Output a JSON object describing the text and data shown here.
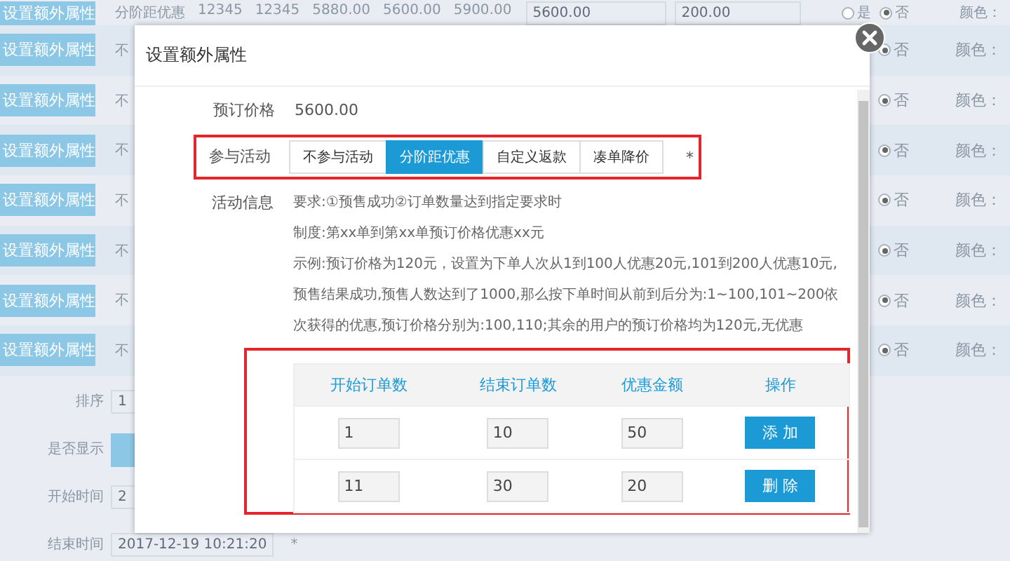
{
  "background": {
    "rows": [
      {
        "button": "设置额外属性",
        "cells": [
          "分阶距优惠",
          "12345",
          "12345",
          "5880.00",
          "5600.00",
          "5900.00"
        ],
        "fields": [
          "5600.00",
          "200.00"
        ],
        "radio": [
          {
            "label": "是",
            "selected": false
          },
          {
            "label": "否",
            "selected": true
          }
        ],
        "color_label": "颜色："
      },
      {
        "button": "设置额外属性",
        "cells": [
          "不"
        ],
        "fields": [],
        "radio": [
          {
            "label": "否",
            "selected": true
          }
        ],
        "color_label": "颜色："
      },
      {
        "button": "设置额外属性",
        "cells": [
          "不"
        ],
        "fields": [],
        "radio": [
          {
            "label": "否",
            "selected": true
          }
        ],
        "color_label": "颜色："
      },
      {
        "button": "设置额外属性",
        "cells": [
          "不"
        ],
        "fields": [],
        "radio": [
          {
            "label": "否",
            "selected": true
          }
        ],
        "color_label": "颜色："
      },
      {
        "button": "设置额外属性",
        "cells": [
          "不"
        ],
        "fields": [],
        "radio": [
          {
            "label": "否",
            "selected": true
          }
        ],
        "color_label": "颜色："
      },
      {
        "button": "设置额外属性",
        "cells": [
          "不"
        ],
        "fields": [],
        "radio": [
          {
            "label": "否",
            "selected": true
          }
        ],
        "color_label": "颜色："
      },
      {
        "button": "设置额外属性",
        "cells": [
          "不"
        ],
        "fields": [],
        "radio": [
          {
            "label": "否",
            "selected": true
          }
        ],
        "color_label": "颜色："
      },
      {
        "button": "设置额外属性",
        "cells": [
          "不"
        ],
        "fields": [],
        "radio": [
          {
            "label": "否",
            "selected": true
          }
        ],
        "color_label": "颜色："
      }
    ],
    "form": [
      {
        "label": "排序",
        "kind": "field",
        "value": "1"
      },
      {
        "label": "是否显示",
        "kind": "button"
      },
      {
        "label": "开始时间",
        "kind": "field",
        "value": "2"
      },
      {
        "label": "结束时间",
        "kind": "field",
        "value": "2017-12-19 10:21:20",
        "required": "*"
      }
    ]
  },
  "dialog": {
    "title": "设置额外属性",
    "price": {
      "label": "预订价格",
      "value": "5600.00"
    },
    "activity": {
      "label": "参与活动",
      "options": [
        {
          "label": "不参与活动",
          "selected": false
        },
        {
          "label": "分阶距优惠",
          "selected": true
        },
        {
          "label": "自定义返款",
          "selected": false
        },
        {
          "label": "凑单降价",
          "selected": false
        }
      ],
      "required": "*"
    },
    "info": {
      "label": "活动信息",
      "lines": [
        "要求:①预售成功②订单数量达到指定要求时",
        "制度:第xx单到第xx单预订价格优惠xx元",
        "示例:预订价格为120元，设置为下单人次从1到100人优惠20元,101到200人优惠10元,预售结果成功,预售人数达到了1000,那么按下单时间从前到后分为:1~100,101~200依次获得的优惠,预订价格分别为:100,110;其余的用户的预订价格均为120元,无优惠"
      ]
    },
    "tiers": {
      "columns": [
        "开始订单数",
        "结束订单数",
        "优惠金额",
        "操作"
      ],
      "rows": [
        {
          "start": "1",
          "end": "10",
          "discount": "50",
          "action": "添 加"
        },
        {
          "start": "11",
          "end": "30",
          "discount": "20",
          "action": "删 除"
        }
      ]
    }
  }
}
